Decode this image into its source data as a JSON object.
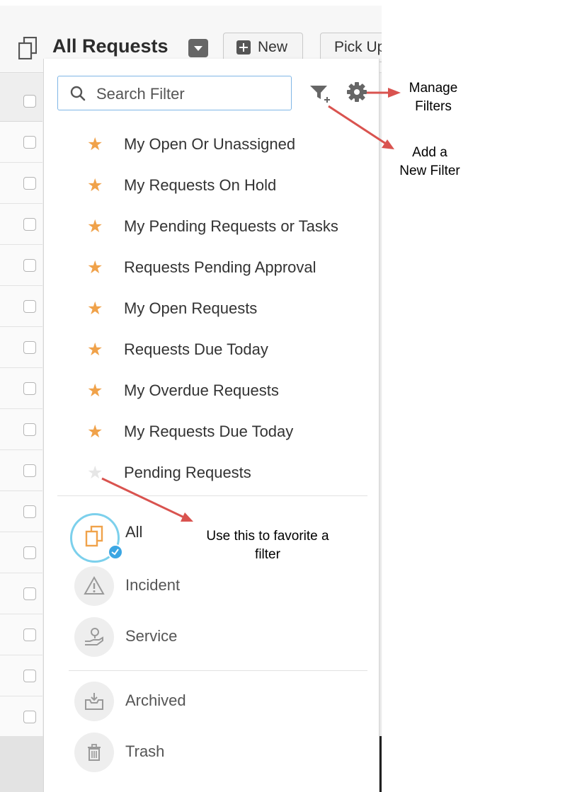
{
  "header": {
    "title": "All Requests",
    "new_label": "New",
    "pickup_label": "Pick Up"
  },
  "search": {
    "placeholder": "Search Filter",
    "value": ""
  },
  "filters": [
    {
      "label": "My Open Or Unassigned",
      "favorite": true
    },
    {
      "label": "My Requests On Hold",
      "favorite": true
    },
    {
      "label": "My Pending Requests or Tasks",
      "favorite": true
    },
    {
      "label": "Requests Pending Approval",
      "favorite": true
    },
    {
      "label": "My Open Requests",
      "favorite": true
    },
    {
      "label": "Requests Due Today",
      "favorite": true
    },
    {
      "label": "My Overdue Requests",
      "favorite": true
    },
    {
      "label": "My Requests Due Today",
      "favorite": true
    },
    {
      "label": "Pending Requests",
      "favorite": false
    }
  ],
  "categories": [
    {
      "label": "All",
      "selected": true,
      "icon": "requests-icon"
    },
    {
      "label": "Incident",
      "selected": false,
      "icon": "warning-icon"
    },
    {
      "label": "Service",
      "selected": false,
      "icon": "service-hand-icon"
    }
  ],
  "extra_categories": [
    {
      "label": "Archived",
      "icon": "archive-icon"
    },
    {
      "label": "Trash",
      "icon": "trash-icon"
    }
  ],
  "annotations": {
    "manage_filters": [
      "Manage",
      "Filters"
    ],
    "add_filter": [
      "Add a",
      "New Filter"
    ],
    "favorite_hint": [
      "Use this to favorite a",
      "filter"
    ]
  },
  "colors": {
    "star_favorite": "#f0a24a",
    "star_inactive": "#e6e6e6",
    "search_border": "#7fb6e6",
    "arrow": "#d9534f",
    "all_ring": "#7cd0ec",
    "check_badge": "#3ba6e3"
  }
}
